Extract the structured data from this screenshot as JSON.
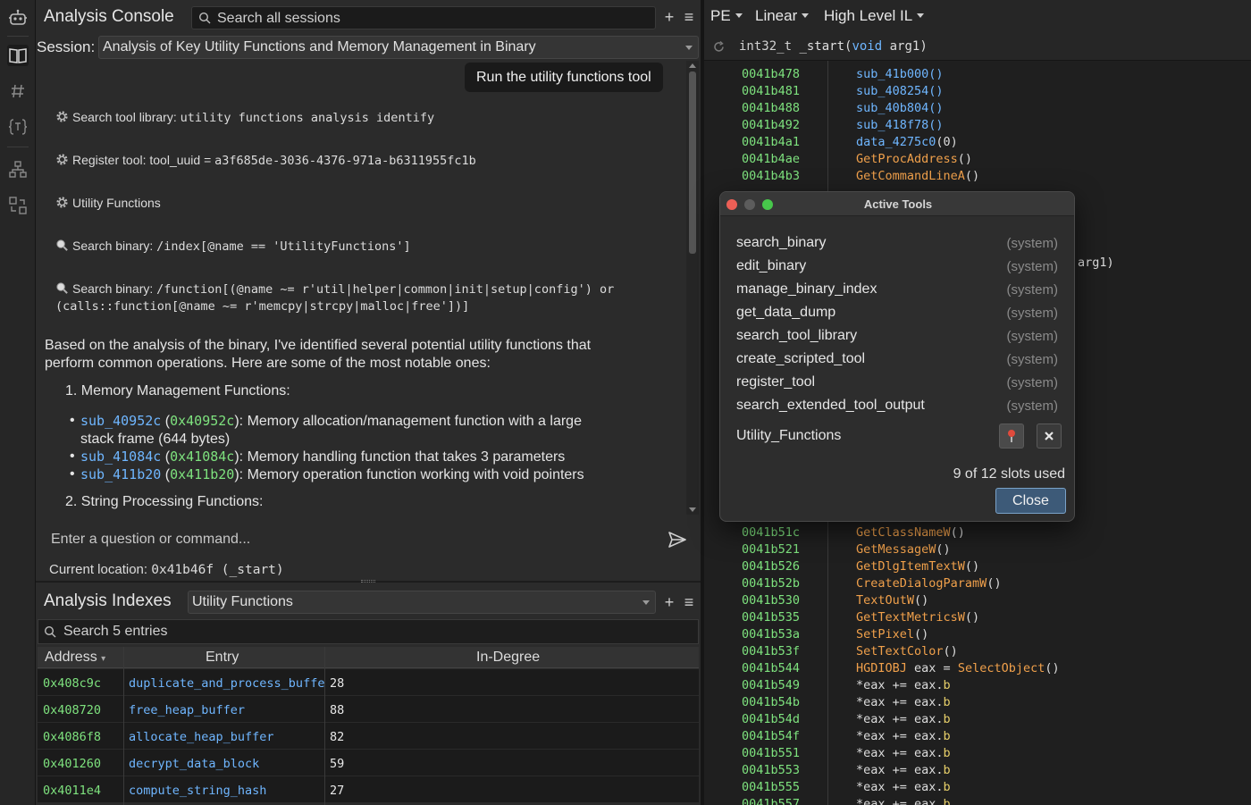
{
  "console": {
    "title": "Analysis Console",
    "search_placeholder": "Search all sessions",
    "add": "+",
    "menu": "≡",
    "session_label": "Session:",
    "session_value": "Analysis of Key Utility Functions and Memory Management in Binary",
    "user_message": "Run the utility functions tool",
    "tool_lines": [
      {
        "prefix": "Search tool library: ",
        "code": "utility functions analysis identify"
      },
      {
        "prefix": "Register tool: tool_uuid = ",
        "code": "a3f685de-3036-4376-971a-b6311955fc1b"
      },
      {
        "prefix": "Utility Functions",
        "code": ""
      },
      {
        "prefix": "Search binary: ",
        "code": "/index[@name == 'UtilityFunctions']"
      },
      {
        "prefix": "Search binary: ",
        "code": "/function[(@name ~= r'util|helper|common|init|setup|config') or",
        "cont": "(calls::function[@name ~= r'memcpy|strcpy|malloc|free'])]"
      }
    ],
    "answer_para1": "Based on the analysis of the binary, I've identified several potential utility functions that",
    "answer_para2": "perform common operations. Here are some of the most notable ones:",
    "heading1": "1. Memory Management Functions:",
    "bullets": [
      {
        "fn": "sub_40952c",
        "addr": "0x40952c",
        "desc": ": Memory allocation/management function with a large",
        "desc2": "stack frame (644 bytes)"
      },
      {
        "fn": "sub_41084c",
        "addr": "0x41084c",
        "desc": ": Memory handling function that takes 3 parameters"
      },
      {
        "fn": "sub_411b20",
        "addr": "0x411b20",
        "desc": ": Memory operation function working with void pointers"
      }
    ],
    "heading2": "2. String Processing Functions:",
    "input_placeholder": "Enter a question or command...",
    "current_location_label": "Current location: ",
    "current_location_value": "0x41b46f (_start)"
  },
  "indexes": {
    "title": "Analysis Indexes",
    "selected": "Utility Functions",
    "search_placeholder": "Search 5 entries",
    "columns": [
      "Address",
      "Entry",
      "In-Degree"
    ],
    "rows": [
      {
        "address": "0x408c9c",
        "entry": "duplicate_and_process_buffer",
        "in_degree": "28"
      },
      {
        "address": "0x408720",
        "entry": "free_heap_buffer",
        "in_degree": "88"
      },
      {
        "address": "0x4086f8",
        "entry": "allocate_heap_buffer",
        "in_degree": "82"
      },
      {
        "address": "0x401260",
        "entry": "decrypt_data_block",
        "in_degree": "59"
      },
      {
        "address": "0x4011e4",
        "entry": "compute_string_hash",
        "in_degree": "27"
      }
    ]
  },
  "disasm": {
    "toolbar": [
      "PE",
      "Linear",
      "High Level IL"
    ],
    "signature": {
      "ret": "int32_t ",
      "name": "_start",
      "args_open": "(",
      "arg_type": "void",
      "arg_name": " arg1",
      "args_close": ")"
    },
    "peek_arg": "arg1)",
    "lines_top": [
      {
        "addr": "0041b478",
        "text": "sub_41b000()",
        "kind": "fnc"
      },
      {
        "addr": "0041b481",
        "text": "sub_408254()",
        "kind": "fnc"
      },
      {
        "addr": "0041b488",
        "text": "sub_40b804()",
        "kind": "fnc"
      },
      {
        "addr": "0041b492",
        "text": "sub_418f78()",
        "kind": "fnc"
      },
      {
        "addr": "0041b4a1",
        "text": "data_4275c0",
        "kind": "dat",
        "tail": "(0)"
      },
      {
        "addr": "0041b4ae",
        "text": "GetProcAddress",
        "kind": "imp",
        "tail": "()"
      },
      {
        "addr": "0041b4b3",
        "text": "GetCommandLineA",
        "kind": "imp",
        "tail": "()"
      }
    ],
    "lines_bottom": [
      {
        "addr": "0041b51c",
        "text": "GetClassNameW",
        "kind": "imp",
        "tail": "()"
      },
      {
        "addr": "0041b521",
        "text": "GetMessageW",
        "kind": "imp",
        "tail": "()"
      },
      {
        "addr": "0041b526",
        "text": "GetDlgItemTextW",
        "kind": "imp",
        "tail": "()"
      },
      {
        "addr": "0041b52b",
        "text": "CreateDialogParamW",
        "kind": "imp",
        "tail": "()"
      },
      {
        "addr": "0041b530",
        "text": "TextOutW",
        "kind": "imp",
        "tail": "()"
      },
      {
        "addr": "0041b535",
        "text": "GetTextMetricsW",
        "kind": "imp",
        "tail": "()"
      },
      {
        "addr": "0041b53a",
        "text": "SetPixel",
        "kind": "imp",
        "tail": "()"
      },
      {
        "addr": "0041b53f",
        "text": "SetTextColor",
        "kind": "imp",
        "tail": "()"
      },
      {
        "addr": "0041b544",
        "text": "HGDIOBJ",
        "kind": "typ",
        "tail": " eax = ",
        "fn2": "SelectObject",
        "tail2": "()"
      },
      {
        "addr": "0041b549",
        "text": "*eax += eax.",
        "kind": "wht",
        "fld": "b"
      },
      {
        "addr": "0041b54b",
        "text": "*eax += eax.",
        "kind": "wht",
        "fld": "b"
      },
      {
        "addr": "0041b54d",
        "text": "*eax += eax.",
        "kind": "wht",
        "fld": "b"
      },
      {
        "addr": "0041b54f",
        "text": "*eax += eax.",
        "kind": "wht",
        "fld": "b"
      },
      {
        "addr": "0041b551",
        "text": "*eax += eax.",
        "kind": "wht",
        "fld": "b"
      },
      {
        "addr": "0041b553",
        "text": "*eax += eax.",
        "kind": "wht",
        "fld": "b"
      },
      {
        "addr": "0041b555",
        "text": "*eax += eax.",
        "kind": "wht",
        "fld": "b"
      },
      {
        "addr": "0041b557",
        "text": "*eax += eax.",
        "kind": "wht",
        "fld": "b"
      }
    ]
  },
  "dialog": {
    "title": "Active Tools",
    "tools": [
      {
        "name": "search_binary",
        "tag": "(system)"
      },
      {
        "name": "edit_binary",
        "tag": "(system)"
      },
      {
        "name": "manage_binary_index",
        "tag": "(system)"
      },
      {
        "name": "get_data_dump",
        "tag": "(system)"
      },
      {
        "name": "search_tool_library",
        "tag": "(system)"
      },
      {
        "name": "create_scripted_tool",
        "tag": "(system)"
      },
      {
        "name": "register_tool",
        "tag": "(system)"
      },
      {
        "name": "search_extended_tool_output",
        "tag": "(system)"
      }
    ],
    "custom_tool": "Utility_Functions",
    "slots": "9 of 12 slots used",
    "close": "Close"
  },
  "colors": {
    "background": "#1e1e1e",
    "panel": "#2b2b2b",
    "address_green": "#7ee27e",
    "function_blue": "#6fb6ff",
    "import_orange": "#f0a04b",
    "primary_button": "#3d5a78"
  }
}
